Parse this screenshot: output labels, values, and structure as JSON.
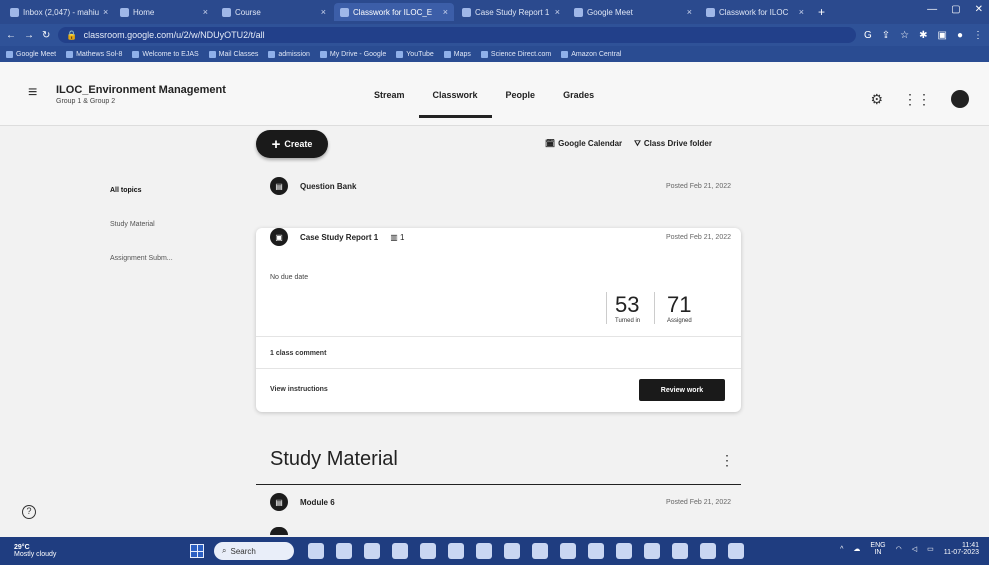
{
  "browser": {
    "tabs": [
      {
        "label": "Inbox (2,047) - mahiu",
        "active": false
      },
      {
        "label": "Home",
        "active": false
      },
      {
        "label": "Course",
        "active": false
      },
      {
        "label": "Classwork for ILOC_E",
        "active": true
      },
      {
        "label": "Case Study Report 1",
        "active": false
      },
      {
        "label": "Google Meet",
        "active": false
      },
      {
        "label": "Classwork for ILOC",
        "active": false
      }
    ],
    "url": "classroom.google.com/u/2/w/NDUyOTU2/t/all",
    "bookmarks": [
      "Google Meet",
      "Mathews Sol-8",
      "Welcome to EJAS",
      "Mail Classes",
      "admission",
      "My Drive - Google",
      "YouTube",
      "Maps",
      "Science Direct.com",
      "Amazon Central"
    ]
  },
  "header": {
    "class_title": "ILOC_Environment Management",
    "class_sub": "Group 1 & Group 2",
    "nav": [
      "Stream",
      "Classwork",
      "People",
      "Grades"
    ],
    "active_nav": "Classwork"
  },
  "toolbar": {
    "create_label": "Create",
    "calendar_label": "Google Calendar",
    "drive_label": "Class Drive folder"
  },
  "topics": {
    "all": "All topics",
    "items": [
      "Study Material",
      "Assignment Subm..."
    ]
  },
  "items": {
    "question_bank": {
      "title": "Question Bank",
      "posted": "Posted Feb 21, 2022"
    },
    "case_study": {
      "title": "Case Study Report 1",
      "posted": "Posted Feb 21, 2022"
    }
  },
  "card": {
    "due": "No due date",
    "turned_in_value": "53",
    "turned_in_label": "Turned in",
    "assigned_value": "71",
    "assigned_label": "Assigned",
    "comment": "1 class comment",
    "view": "View instructions",
    "review": "Review work"
  },
  "section": {
    "title": "Study Material",
    "module_title": "Module 6",
    "module_posted": "Posted Feb 21, 2022"
  },
  "taskbar": {
    "temp": "29°C",
    "weather": "Mostly cloudy",
    "search": "Search",
    "lang_top": "ENG",
    "lang_bottom": "IN",
    "time": "11:41",
    "date": "11-07-2023"
  }
}
